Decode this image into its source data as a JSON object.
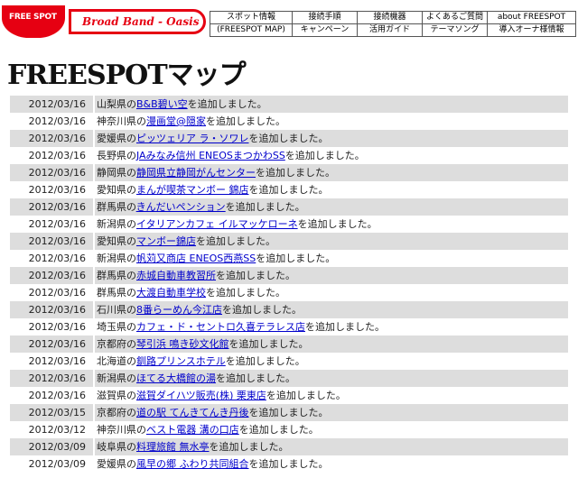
{
  "header": {
    "logo_text": "FREE SPOT",
    "brand": "Broad Band - Oasis",
    "nav": [
      {
        "top": "スポット情報",
        "bottom": "(FREESPOT MAP)"
      },
      {
        "top": "接続手順",
        "bottom": "キャンペーン"
      },
      {
        "top": "接続機器",
        "bottom": "活用ガイド"
      },
      {
        "top": "よくあるご質問",
        "bottom": "テーマソング"
      },
      {
        "top": "about FREESPOT",
        "bottom": "導入オーナ様情報"
      }
    ]
  },
  "page_title": "FREESPOTマップ",
  "entries": [
    {
      "date": "2012/03/16",
      "pref": "山梨県の",
      "link": "B&B碧い空",
      "suffix": "を追加しました。"
    },
    {
      "date": "2012/03/16",
      "pref": "神奈川県の",
      "link": "漫画堂@隠家",
      "suffix": "を追加しました。"
    },
    {
      "date": "2012/03/16",
      "pref": "愛媛県の",
      "link": "ピッツェリア ラ・ソワレ",
      "suffix": "を追加しました。"
    },
    {
      "date": "2012/03/16",
      "pref": "長野県の",
      "link": "JAみなみ信州 ENEOSまつかわSS",
      "suffix": "を追加しました。"
    },
    {
      "date": "2012/03/16",
      "pref": "静岡県の",
      "link": "静岡県立静岡がんセンター",
      "suffix": "を追加しました。"
    },
    {
      "date": "2012/03/16",
      "pref": "愛知県の",
      "link": "まんが喫茶マンボー 錦店",
      "suffix": "を追加しました。"
    },
    {
      "date": "2012/03/16",
      "pref": "群馬県の",
      "link": "きんだいペンション",
      "suffix": "を追加しました。"
    },
    {
      "date": "2012/03/16",
      "pref": "新潟県の",
      "link": "イタリアンカフェ イルマッケローネ",
      "suffix": "を追加しました。"
    },
    {
      "date": "2012/03/16",
      "pref": "愛知県の",
      "link": "マンボー錦店",
      "suffix": "を追加しました。"
    },
    {
      "date": "2012/03/16",
      "pref": "新潟県の",
      "link": "帆苅又商店 ENEOS西燕SS",
      "suffix": "を追加しました。"
    },
    {
      "date": "2012/03/16",
      "pref": "群馬県の",
      "link": "赤城自動車教習所",
      "suffix": "を追加しました。"
    },
    {
      "date": "2012/03/16",
      "pref": "群馬県の",
      "link": "大渡自動車学校",
      "suffix": "を追加しました。"
    },
    {
      "date": "2012/03/16",
      "pref": "石川県の",
      "link": "8番らーめん今江店",
      "suffix": "を追加しました。"
    },
    {
      "date": "2012/03/16",
      "pref": "埼玉県の",
      "link": "カフェ・ド・セントロ久喜テラレス店",
      "suffix": "を追加しました。"
    },
    {
      "date": "2012/03/16",
      "pref": "京都府の",
      "link": "琴引浜 鳴き砂文化館",
      "suffix": "を追加しました。"
    },
    {
      "date": "2012/03/16",
      "pref": "北海道の",
      "link": "釧路プリンスホテル",
      "suffix": "を追加しました。"
    },
    {
      "date": "2012/03/16",
      "pref": "新潟県の",
      "link": "ほてる大橋館の湯",
      "suffix": "を追加しました。"
    },
    {
      "date": "2012/03/16",
      "pref": "滋賀県の",
      "link": "滋賀ダイハツ販売(株) 栗東店",
      "suffix": "を追加しました。"
    },
    {
      "date": "2012/03/15",
      "pref": "京都府の",
      "link": "道の駅 てんきてんき丹後",
      "suffix": "を追加しました。"
    },
    {
      "date": "2012/03/12",
      "pref": "神奈川県の",
      "link": "ベスト電器 溝の口店",
      "suffix": "を追加しました。"
    },
    {
      "date": "2012/03/09",
      "pref": "岐阜県の",
      "link": "料理旅館 無水亭",
      "suffix": "を追加しました。"
    },
    {
      "date": "2012/03/09",
      "pref": "愛媛県の",
      "link": "風早の郷 ふわり共同組合",
      "suffix": "を追加しました。"
    }
  ]
}
